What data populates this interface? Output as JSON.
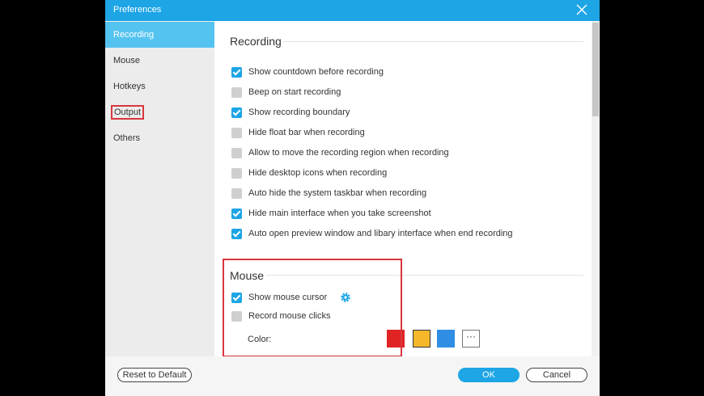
{
  "window": {
    "title": "Preferences"
  },
  "sidebar": {
    "items": [
      {
        "label": "Recording"
      },
      {
        "label": "Mouse"
      },
      {
        "label": "Hotkeys"
      },
      {
        "label": "Output"
      },
      {
        "label": "Others"
      }
    ]
  },
  "recording": {
    "title": "Recording",
    "options": [
      {
        "label": "Show countdown before recording",
        "checked": true
      },
      {
        "label": "Beep on start recording",
        "checked": false
      },
      {
        "label": "Show recording boundary",
        "checked": true
      },
      {
        "label": "Hide float bar when recording",
        "checked": false
      },
      {
        "label": "Allow to move the recording region when recording",
        "checked": false
      },
      {
        "label": "Hide desktop icons when recording",
        "checked": false
      },
      {
        "label": "Auto hide the system taskbar when recording",
        "checked": false
      },
      {
        "label": "Hide main interface when you take screenshot",
        "checked": true
      },
      {
        "label": "Auto open preview window and libary interface when end recording",
        "checked": true
      }
    ]
  },
  "mouse": {
    "title": "Mouse",
    "options": [
      {
        "label": "Show mouse cursor",
        "checked": true
      },
      {
        "label": "Record mouse clicks",
        "checked": false
      }
    ],
    "color_label": "Color:",
    "more_label": "···",
    "colors": [
      "#e02424",
      "#f6b82b",
      "#2f8de4"
    ]
  },
  "footer": {
    "reset_label": "Reset to Default",
    "ok_label": "OK",
    "cancel_label": "Cancel"
  },
  "theme": {
    "accent": "#1da5e6",
    "highlight": "#d9363e"
  }
}
